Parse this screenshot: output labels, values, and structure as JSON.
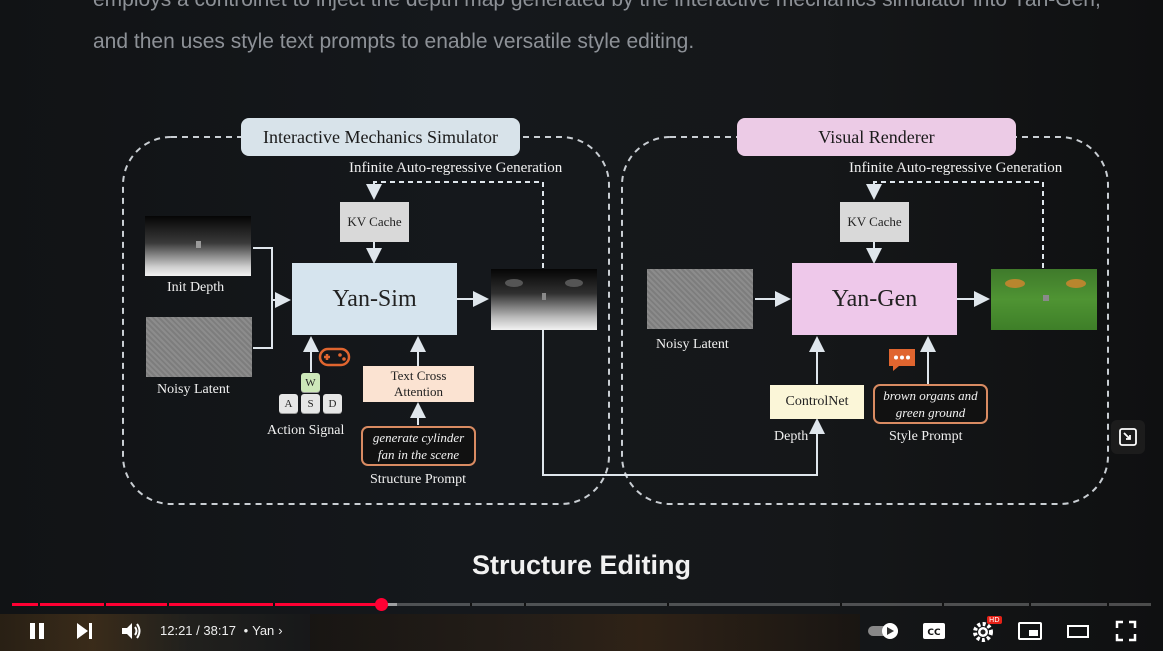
{
  "paragraph": {
    "line1": "employs a controlnet to inject the depth map generated by the interactive mechanics simulator into Yan-Gen,",
    "line2": "and then uses style text prompts to enable versatile style editing."
  },
  "diagram": {
    "left_panel": {
      "title": "Interactive Mechanics Simulator",
      "loop_label": "Infinite Auto-regressive Generation",
      "kv_cache": "KV Cache",
      "init_depth": "Init Depth",
      "noisy_latent": "Noisy Latent",
      "model": "Yan-Sim",
      "keys": [
        "W",
        "A",
        "S",
        "D"
      ],
      "action_signal": "Action Signal",
      "text_cross_line1": "Text Cross",
      "text_cross_line2": "Attention",
      "prompt_line1": "generate cylinder",
      "prompt_line2": "fan in the scene",
      "structure_prompt": "Structure Prompt"
    },
    "right_panel": {
      "title": "Visual Renderer",
      "loop_label": "Infinite Auto-regressive Generation",
      "kv_cache": "KV Cache",
      "noisy_latent": "Noisy Latent",
      "model": "Yan-Gen",
      "controlnet": "ControlNet",
      "depth": "Depth",
      "prompt_line1": "brown organs and",
      "prompt_line2": "green ground",
      "style_prompt": "Style Prompt"
    }
  },
  "caption": "Structure Editing",
  "player": {
    "current_time": "12:21",
    "duration": "38:17",
    "separator": " / ",
    "bullet": "•",
    "chapter": "Yan",
    "progress_fraction": 0.324,
    "hd_badge": "HD",
    "icons": [
      "pause-icon",
      "next-icon",
      "volume-icon",
      "autoplay-toggle-icon",
      "captions-icon",
      "settings-icon",
      "miniplayer-icon",
      "theater-icon",
      "fullscreen-icon"
    ]
  },
  "colors": {
    "sim_title_bg": "#d8e3ea",
    "renderer_title_bg": "#eccbe6",
    "yan_sim_bg": "#d6e4ee",
    "yan_gen_bg": "#eec8ea",
    "kv_bg": "#d9d9d9",
    "text_cross_bg": "#fbe3d2",
    "controlnet_bg": "#fbf6d8",
    "prompt_border": "#d98b62",
    "progress_red": "#ff0033"
  }
}
